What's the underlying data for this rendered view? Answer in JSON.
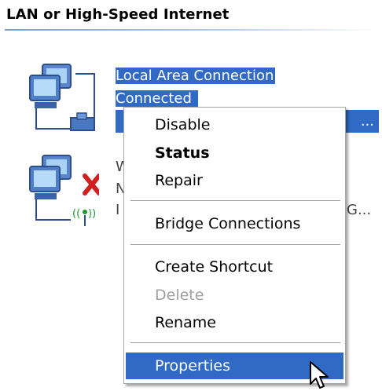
{
  "group": {
    "title": "LAN or High-Speed Internet"
  },
  "connections": [
    {
      "name": "Local Area Connection",
      "status": "Connected",
      "status_fragment": "...",
      "selected": true
    },
    {
      "name_fragment": "W",
      "status_fragment": "N",
      "device_fragment": "I",
      "device_trailing": "G...",
      "selected": false
    }
  ],
  "context_menu": {
    "items": [
      {
        "label": "Disable",
        "bold": false,
        "enabled": true
      },
      {
        "label": "Status",
        "bold": true,
        "enabled": true
      },
      {
        "label": "Repair",
        "bold": false,
        "enabled": true
      },
      {
        "label": "Bridge Connections",
        "bold": false,
        "enabled": true
      },
      {
        "label": "Create Shortcut",
        "bold": false,
        "enabled": true
      },
      {
        "label": "Delete",
        "bold": false,
        "enabled": false
      },
      {
        "label": "Rename",
        "bold": false,
        "enabled": true
      },
      {
        "label": "Properties",
        "bold": false,
        "enabled": true,
        "hovered": true
      }
    ]
  },
  "colors": {
    "selection": "#316ac5",
    "disabled_text": "#a0a0a0",
    "error_x": "#d0201f"
  },
  "icons": [
    "lan-connection-icon",
    "wireless-disconnected-icon",
    "red-x-icon",
    "pointer-cursor-icon"
  ]
}
